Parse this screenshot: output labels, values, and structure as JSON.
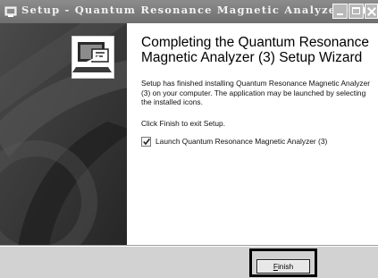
{
  "window": {
    "title": "Setup - Quantum Resonance Magnetic Analyzer (3)",
    "title_icon": "setup-icon",
    "controls": [
      "minimize-icon",
      "maximize-icon",
      "close-icon"
    ]
  },
  "sidebar": {
    "product_icon": "installer-computer-icon"
  },
  "main": {
    "heading": "Completing the Quantum Resonance Magnetic Analyzer (3) Setup Wizard",
    "body": "Setup has finished installing Quantum Resonance Magnetic Analyzer (3) on your computer. The application may be launched by selecting the installed icons.",
    "instruction": "Click Finish to exit Setup.",
    "launch_checkbox": {
      "label": "Launch Quantum Resonance Magnetic Analyzer (3)",
      "checked": true
    }
  },
  "footer": {
    "finish_button": {
      "mnemonic": "F",
      "rest": "inish"
    }
  }
}
